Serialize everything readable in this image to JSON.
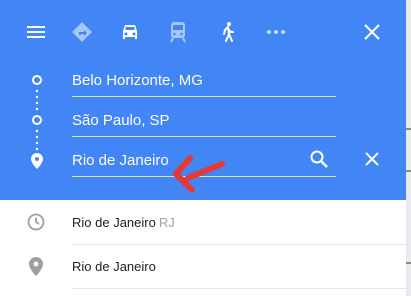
{
  "header": {
    "modes": [
      {
        "icon": "menu-icon"
      },
      {
        "icon": "best-route-icon"
      },
      {
        "icon": "car-icon",
        "selected": true
      },
      {
        "icon": "transit-icon"
      },
      {
        "icon": "walking-icon"
      },
      {
        "icon": "more-icon"
      },
      {
        "icon": "close-icon"
      }
    ],
    "colors": {
      "header_bg": "#4285f4",
      "text": "#ffffff"
    }
  },
  "route": {
    "origin": "Belo Horizonte, MG",
    "waypoint": "São Paulo, SP",
    "destination": "Rio de Janeiro"
  },
  "suggestions": [
    {
      "icon": "clock-icon",
      "label": "Rio de Janeiro",
      "sub": "RJ"
    },
    {
      "icon": "place-pin-icon",
      "label": "Rio de Janeiro",
      "sub": ""
    }
  ],
  "annotation": {
    "icon": "red-arrow-icon",
    "color": "#e53935"
  }
}
